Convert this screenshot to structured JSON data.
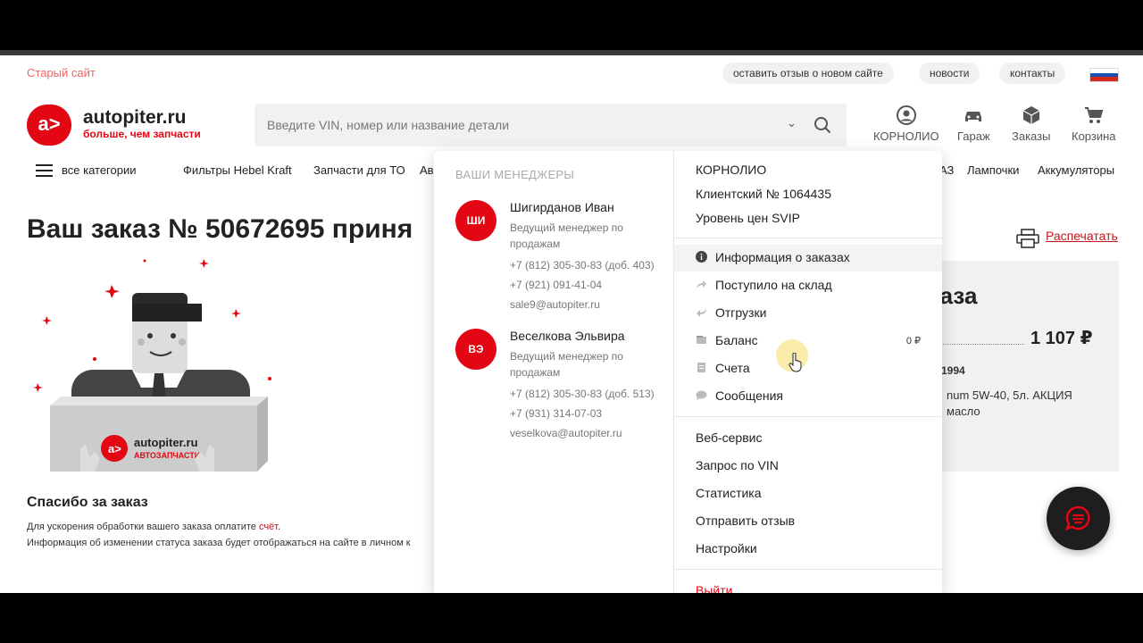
{
  "topbar": {
    "old_site": "Старый сайт",
    "links": [
      "оставить отзыв о новом сайте",
      "новости",
      "контакты"
    ]
  },
  "logo": {
    "mark": "a>",
    "name": "autopiter.ru",
    "tagline": "больше, чем запчасти"
  },
  "search": {
    "placeholder": "Введите VIN, номер или название детали"
  },
  "header_icons": [
    {
      "label": "КОРНОЛИО",
      "icon": "user-icon"
    },
    {
      "label": "Гараж",
      "icon": "car-icon"
    },
    {
      "label": "Заказы",
      "icon": "box-icon"
    },
    {
      "label": "Корзина",
      "icon": "cart-icon"
    }
  ],
  "nav": {
    "all_categories": "все категории",
    "items": [
      "Фильтры Hebel Kraft",
      "Запчасти для ТО",
      "Ав",
      "АЗ",
      "Лампочки",
      "Аккумуляторы"
    ]
  },
  "order": {
    "title": "Ваш заказ № 50672695 приня",
    "print": "Распечатать",
    "thanks": "Спасибо за заказ",
    "note1_prefix": "Для ускорения обработки вашего заказа оплатите ",
    "note1_link": "счёт",
    "note1_suffix": ".",
    "note2": "Информация об изменении статуса заказа будет отображаться на сайте в личном к",
    "illus_brand": "autopiter.ru",
    "illus_sub": "АВТОЗАПЧАСТИ"
  },
  "summary": {
    "title": "заза",
    "price": "1 107 ₽",
    "code": "1994",
    "product_line1": "num 5W-40, 5л. АКЦИЯ",
    "product_line2": "масло"
  },
  "dropdown": {
    "managers_heading": "ВАШИ МЕНЕДЖЕРЫ",
    "managers": [
      {
        "initials": "ШИ",
        "name": "Шигирданов Иван",
        "role": "Ведущий менеджер по продажам",
        "phone1": "+7 (812) 305-30-83 (доб. 403)",
        "phone2": "+7 (921) 091-41-04",
        "email": "sale9@autopiter.ru"
      },
      {
        "initials": "ВЭ",
        "name": "Веселкова Эльвира",
        "role": "Ведущий менеджер по продажам",
        "phone1": "+7 (812) 305-30-83 (доб. 513)",
        "phone2": "+7 (931) 314-07-03",
        "email": "veselkova@autopiter.ru"
      }
    ],
    "account": {
      "name": "КОРНОЛИО",
      "client": "Клиентский № 1064435",
      "price_level": "Уровень цен SVIP"
    },
    "menu": [
      {
        "label": "Информация о заказах",
        "icon": "info-icon"
      },
      {
        "label": "Поступило на склад",
        "icon": "forward-arrow-icon"
      },
      {
        "label": "Отгрузки",
        "icon": "return-arrow-icon"
      },
      {
        "label": "Баланс",
        "icon": "wallet-icon",
        "value": "0 ₽"
      },
      {
        "label": "Счета",
        "icon": "invoice-icon"
      },
      {
        "label": "Сообщения",
        "icon": "chat-bubble-icon"
      }
    ],
    "menu2": [
      "Веб-сервис",
      "Запрос по VIN",
      "Статистика",
      "Отправить отзыв",
      "Настройки"
    ],
    "logout": "Выйти"
  },
  "colors": {
    "brand": "#e30613",
    "accent_link": "#c4161c"
  }
}
